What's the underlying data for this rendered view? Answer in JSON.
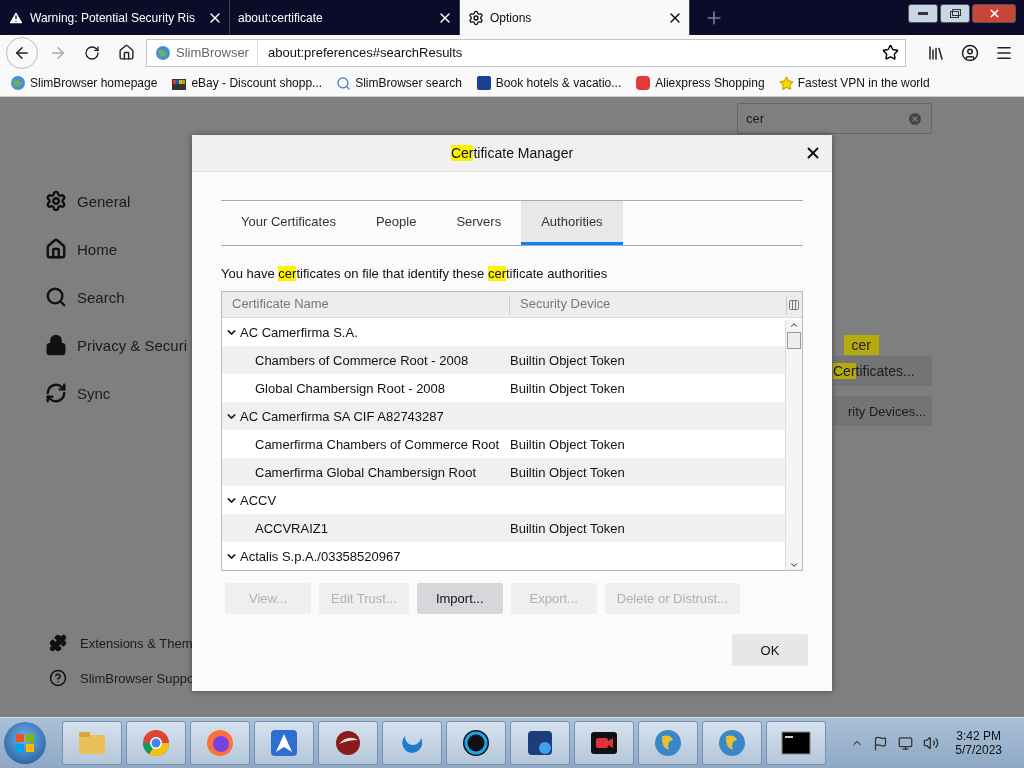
{
  "browser_tabs": [
    {
      "title": "Warning: Potential Security Ris",
      "kind": "warning",
      "selected": false
    },
    {
      "title": "about:certificate",
      "kind": "plain",
      "selected": false
    },
    {
      "title": "Options",
      "kind": "settings",
      "selected": true
    }
  ],
  "url_bar": {
    "identity": "SlimBrowser",
    "url": "about:preferences#searchResults"
  },
  "bookmarks": [
    {
      "label": "SlimBrowser homepage",
      "kind": "globe"
    },
    {
      "label": "eBay - Discount shopp...",
      "kind": "bag"
    },
    {
      "label": "SlimBrowser search",
      "kind": "search"
    },
    {
      "label": "Book hotels & vacatio...",
      "kind": "booking"
    },
    {
      "label": "Aliexpress Shopping",
      "kind": "ali"
    },
    {
      "label": "Fastest VPN in the world",
      "kind": "vpn"
    }
  ],
  "preferences": {
    "search": {
      "value": "cer"
    },
    "sidebar": [
      {
        "label": "General",
        "kind": "general"
      },
      {
        "label": "Home",
        "kind": "home"
      },
      {
        "label": "Search",
        "kind": "search"
      },
      {
        "label": "Privacy & Securi",
        "kind": "privacy"
      },
      {
        "label": "Sync",
        "kind": "sync"
      }
    ],
    "footer_links": [
      {
        "label": "Extensions & Them",
        "kind": "extensions"
      },
      {
        "label": "SlimBrowser Suppo",
        "kind": "support"
      }
    ],
    "search_tooltip": "cer",
    "buttons": [
      [
        {
          "text": "Cer",
          "highlight": true
        },
        {
          "text": "tificates...",
          "highlight": false
        }
      ],
      [
        {
          "text": "rity Devices...",
          "highlight": false
        }
      ]
    ]
  },
  "dialog": {
    "title": [
      {
        "text": "Cer",
        "highlight": true
      },
      {
        "text": "tificate Manager",
        "highlight": false
      }
    ],
    "tabs": [
      {
        "label": "Your Certificates",
        "selected": false
      },
      {
        "label": "People",
        "selected": false
      },
      {
        "label": "Servers",
        "selected": false
      },
      {
        "label": "Authorities",
        "selected": true
      }
    ],
    "description": [
      {
        "text": "You have ",
        "highlight": false
      },
      {
        "text": "cer",
        "highlight": true
      },
      {
        "text": "tificates on file that identify these ",
        "highlight": false
      },
      {
        "text": "cer",
        "highlight": true
      },
      {
        "text": "tificate authorities",
        "highlight": false
      }
    ],
    "columns": [
      "Certificate Name",
      "Security Device"
    ],
    "tree": [
      {
        "name": "AC Camerfirma S.A.",
        "expanded": true,
        "children": [
          {
            "name": "Chambers of Commerce Root - 2008",
            "device": "Builtin Object Token"
          },
          {
            "name": "Global Chambersign Root - 2008",
            "device": "Builtin Object Token"
          }
        ]
      },
      {
        "name": "AC Camerfirma SA CIF A82743287",
        "expanded": true,
        "children": [
          {
            "name": "Camerfirma Chambers of Commerce Root",
            "device": "Builtin Object Token"
          },
          {
            "name": "Camerfirma Global Chambersign Root",
            "device": "Builtin Object Token"
          }
        ]
      },
      {
        "name": "ACCV",
        "expanded": true,
        "children": [
          {
            "name": "ACCVRAIZ1",
            "device": "Builtin Object Token"
          }
        ]
      },
      {
        "name": "Actalis S.p.A./03358520967",
        "expanded": true
      }
    ],
    "buttons": [
      {
        "label": "View...",
        "disabled": true
      },
      {
        "label": "Edit Trust...",
        "disabled": true
      },
      {
        "label": "Import...",
        "disabled": false
      },
      {
        "label": "Export...",
        "disabled": true
      },
      {
        "label": "Delete or Distrust...",
        "disabled": true
      }
    ],
    "ok": "OK"
  },
  "taskbar": {
    "apps": [
      {
        "kind": "folder"
      },
      {
        "kind": "chrome"
      },
      {
        "kind": "firefox"
      },
      {
        "kind": "arrow"
      },
      {
        "kind": "redball"
      },
      {
        "kind": "drop"
      },
      {
        "kind": "cee"
      },
      {
        "kind": "photo"
      },
      {
        "kind": "camera"
      },
      {
        "kind": "globe"
      },
      {
        "kind": "globe"
      },
      {
        "kind": "terminal"
      }
    ],
    "time": "3:42 PM",
    "date": "5/7/2023"
  }
}
